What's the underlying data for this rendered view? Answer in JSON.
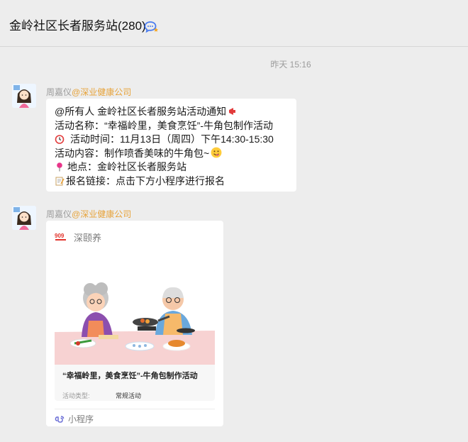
{
  "header": {
    "title": "金岭社区长者服务站(280)",
    "icon": "chat-bubble-icon"
  },
  "time_separator": "昨天 15:16",
  "messages": [
    {
      "sender_name": "周嘉仪",
      "sender_org": "@深业健康公司",
      "lines": [
        "@所有人 金岭社区长者服务站活动通知",
        "活动名称：“幸福岭里，美食烹饪”-牛角包制作活动",
        "活动时间：11月13日（周四）下午14:30-15:30",
        "活动内容：制作喷香美味的牛角包~",
        "地点：金岭社区长者服务站",
        "报名链接：点击下方小程序进行报名"
      ]
    },
    {
      "sender_name": "周嘉仪",
      "sender_org": "@深业健康公司",
      "mini_program": {
        "app_name": "深颐养",
        "card_title": "“幸福岭里，美食烹饪”-牛角包制作活动",
        "meta_label": "活动类型:",
        "meta_value": "常规活动",
        "footer_label": "小程序"
      }
    }
  ]
}
